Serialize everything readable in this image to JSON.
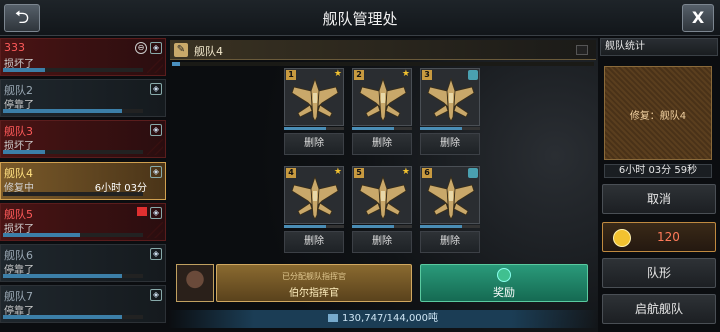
{
  "header": {
    "title": "舰队管理处",
    "back_icon": "back-arrow-icon",
    "close_label": "X"
  },
  "fleets": [
    {
      "name": "333",
      "status": "损坏了",
      "time": "",
      "progress": 0.3,
      "state": "damaged"
    },
    {
      "name": "舰队2",
      "status": "停靠了",
      "time": "",
      "progress": 0.85,
      "state": "docked"
    },
    {
      "name": "舰队3",
      "status": "损坏了",
      "time": "",
      "progress": 0.3,
      "state": "damaged"
    },
    {
      "name": "舰队4",
      "status": "修复中",
      "time": "6小时 03分",
      "progress": 0.0,
      "state": "repair"
    },
    {
      "name": "舰队5",
      "status": "损坏了",
      "time": "",
      "progress": 0.55,
      "state": "damaged"
    },
    {
      "name": "舰队6",
      "status": "停靠了",
      "time": "",
      "progress": 0.85,
      "state": "docked"
    },
    {
      "name": "舰队7",
      "status": "停靠了",
      "time": "",
      "progress": 0.85,
      "state": "docked"
    }
  ],
  "fleet_detail": {
    "name": "舰队4",
    "slots": [
      {
        "number": "1",
        "badge": "star",
        "health": 0.7,
        "delete_label": "删除"
      },
      {
        "number": "2",
        "badge": "star",
        "health": 0.7,
        "delete_label": "删除"
      },
      {
        "number": "3",
        "badge": "stack",
        "health": 0.7,
        "delete_label": "删除"
      },
      {
        "number": "4",
        "badge": "star",
        "health": 0.7,
        "delete_label": "删除"
      },
      {
        "number": "5",
        "badge": "star",
        "health": 0.7,
        "delete_label": "删除"
      },
      {
        "number": "6",
        "badge": "stack",
        "health": 0.7,
        "delete_label": "删除"
      }
    ],
    "commander": {
      "title": "已分配舰队指挥官",
      "name": "伯尔指挥官"
    },
    "reward_label": "奖励",
    "capacity": "130,747/144,000吨"
  },
  "stats_panel": {
    "title": "舰队统计",
    "repair_label": "修复：舰队4",
    "timer": "6小时 03分 59秒",
    "cancel_label": "取消",
    "cost": "120",
    "formation_label": "队形",
    "launch_label": "启航舰队"
  },
  "colors": {
    "accent_gold": "#c9a96a",
    "repair_cost": "#ff7a5a",
    "reward_green": "#2a9a7a"
  }
}
